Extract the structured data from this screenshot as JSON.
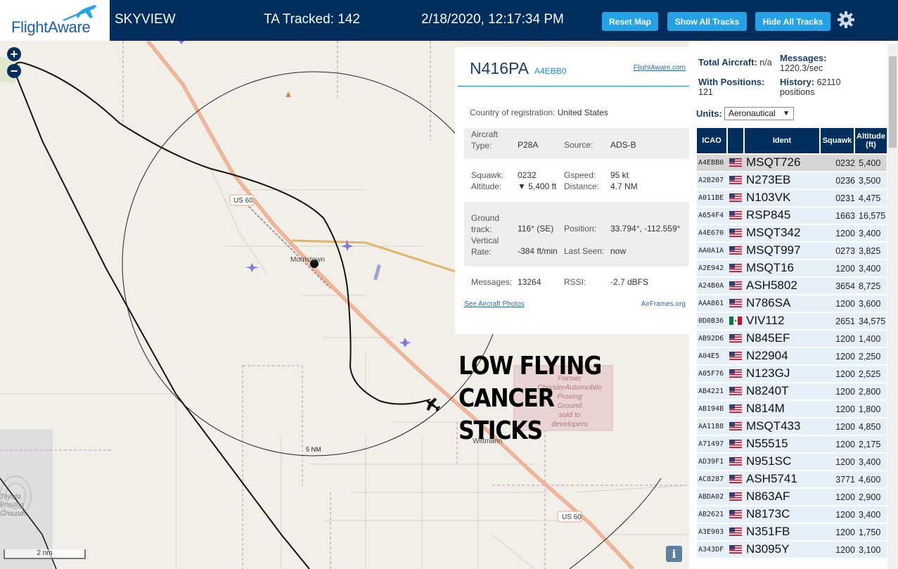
{
  "header": {
    "logo_text": "FlightAware",
    "title": "SKYVIEW",
    "tracked": "TA Tracked: 142",
    "datetime": "2/18/2020, 12:17:34 PM",
    "buttons": {
      "reset": "Reset Map",
      "show": "Show All Tracks",
      "hide": "Hide All Tracks"
    },
    "colors": {
      "bar": "#002f5d",
      "button": "#25a2e6"
    }
  },
  "map": {
    "zoom_in": "+",
    "zoom_out": "−",
    "labels": {
      "us60_a": "US 60",
      "us60_b": "US 60",
      "morristown": "Morristown",
      "wittmann": "Wittmann",
      "ring": "5 NM",
      "proving": [
        "Former",
        "ChryslerAutomobile",
        "Proving",
        "Ground",
        "sold to",
        "developers"
      ],
      "toyota": [
        "Toyota",
        "Proving",
        "Grounds"
      ]
    },
    "scale": "2 nm",
    "info": "i",
    "overlay_text": [
      "LOW FLYING CANCER",
      "STICKS"
    ]
  },
  "popup": {
    "callsign": "N416PA",
    "hex": "A4EBB0",
    "link": "FlightAware.com",
    "country_label": "Country of registration:",
    "country": "United States",
    "aircraft_type_label": [
      "Aircraft",
      "Type:"
    ],
    "aircraft_type": "P28A",
    "source_label": "Source:",
    "source": "ADS-B",
    "squawk_label": "Squawk:",
    "squawk": "0232",
    "altitude_label": "Altitude:",
    "altitude": "▼ 5,400 ft",
    "gspeed_label": "Gspeed:",
    "gspeed": "95 kt",
    "distance_label": "Distance:",
    "distance": "4.7 NM",
    "track_label": [
      "Ground",
      "track:"
    ],
    "track": "116° (SE)",
    "position_label": "Position:",
    "position": "33.794°, -112.559°",
    "vrate_label": [
      "Vertical",
      "Rate:"
    ],
    "vrate": "-384 ft/min",
    "lastseen_label": "Last Seen:",
    "lastseen": "now",
    "messages_label": "Messages:",
    "messages": "13264",
    "rssi_label": "RSSI:",
    "rssi": "-2.7 dBFS",
    "photos_link": "See Aircraft Photos",
    "airframes_link": "AirFrames.org"
  },
  "panel": {
    "total_label": "Total Aircraft:",
    "total": "n/a",
    "messages_label": "Messages:",
    "messages": "1220.3/sec",
    "withpos_label": "With Positions:",
    "withpos": "121",
    "history_label": "History:",
    "history": "62110",
    "history_unit": "positions",
    "units_label": "Units:",
    "units_value": "Aeronautical",
    "columns": {
      "icao": "ICAO",
      "ident": "Ident",
      "squawk": "Squawk",
      "altitude": [
        "Altitude",
        "(ft)"
      ]
    },
    "rows": [
      {
        "icao": "A4EBB0",
        "flag": "us",
        "ident": "MSQT726",
        "squawk": "0232",
        "alt": "5,400"
      },
      {
        "icao": "A2B207",
        "flag": "us",
        "ident": "N273EB",
        "squawk": "0236",
        "alt": "3,500"
      },
      {
        "icao": "A011BE",
        "flag": "us",
        "ident": "N103VK",
        "squawk": "0231",
        "alt": "4,475"
      },
      {
        "icao": "A654F4",
        "flag": "us",
        "ident": "RSP845",
        "squawk": "1663",
        "alt": "16,575"
      },
      {
        "icao": "A4E670",
        "flag": "us",
        "ident": "MSQT342",
        "squawk": "1200",
        "alt": "3,400"
      },
      {
        "icao": "AA0A1A",
        "flag": "us",
        "ident": "MSQT997",
        "squawk": "0273",
        "alt": "3,825"
      },
      {
        "icao": "A2E942",
        "flag": "us",
        "ident": "MSQT16",
        "squawk": "1200",
        "alt": "3,400"
      },
      {
        "icao": "A24B0A",
        "flag": "us",
        "ident": "ASH5802",
        "squawk": "3654",
        "alt": "8,725"
      },
      {
        "icao": "AAA861",
        "flag": "us",
        "ident": "N786SA",
        "squawk": "1200",
        "alt": "3,600"
      },
      {
        "icao": "0D0B36",
        "flag": "mx",
        "ident": "VIV112",
        "squawk": "2651",
        "alt": "34,575"
      },
      {
        "icao": "AB92D6",
        "flag": "us",
        "ident": "N845EF",
        "squawk": "1200",
        "alt": "1,400"
      },
      {
        "icao": "A04E5",
        "flag": "us",
        "ident": "N22904",
        "squawk": "1200",
        "alt": "2,250"
      },
      {
        "icao": "A05F76",
        "flag": "us",
        "ident": "N123GJ",
        "squawk": "1200",
        "alt": "2,525"
      },
      {
        "icao": "AB4221",
        "flag": "us",
        "ident": "N8240T",
        "squawk": "1200",
        "alt": "2,800"
      },
      {
        "icao": "AB194B",
        "flag": "us",
        "ident": "N814M",
        "squawk": "1200",
        "alt": "1,800"
      },
      {
        "icao": "AA1188",
        "flag": "us",
        "ident": "MSQT433",
        "squawk": "1200",
        "alt": "4,850"
      },
      {
        "icao": "A71497",
        "flag": "us",
        "ident": "N55515",
        "squawk": "1200",
        "alt": "2,175"
      },
      {
        "icao": "AD39F1",
        "flag": "us",
        "ident": "N951SC",
        "squawk": "1200",
        "alt": "3,400"
      },
      {
        "icao": "AC8287",
        "flag": "us",
        "ident": "ASH5741",
        "squawk": "3771",
        "alt": "4,600"
      },
      {
        "icao": "ABDA02",
        "flag": "us",
        "ident": "N863AF",
        "squawk": "1200",
        "alt": "2,900"
      },
      {
        "icao": "AB2621",
        "flag": "us",
        "ident": "N8173C",
        "squawk": "1200",
        "alt": "3,400"
      },
      {
        "icao": "A3E903",
        "flag": "us",
        "ident": "N351FB",
        "squawk": "1200",
        "alt": "1,750"
      },
      {
        "icao": "A343DF",
        "flag": "us",
        "ident": "N3095Y",
        "squawk": "1200",
        "alt": "3,100"
      }
    ]
  }
}
